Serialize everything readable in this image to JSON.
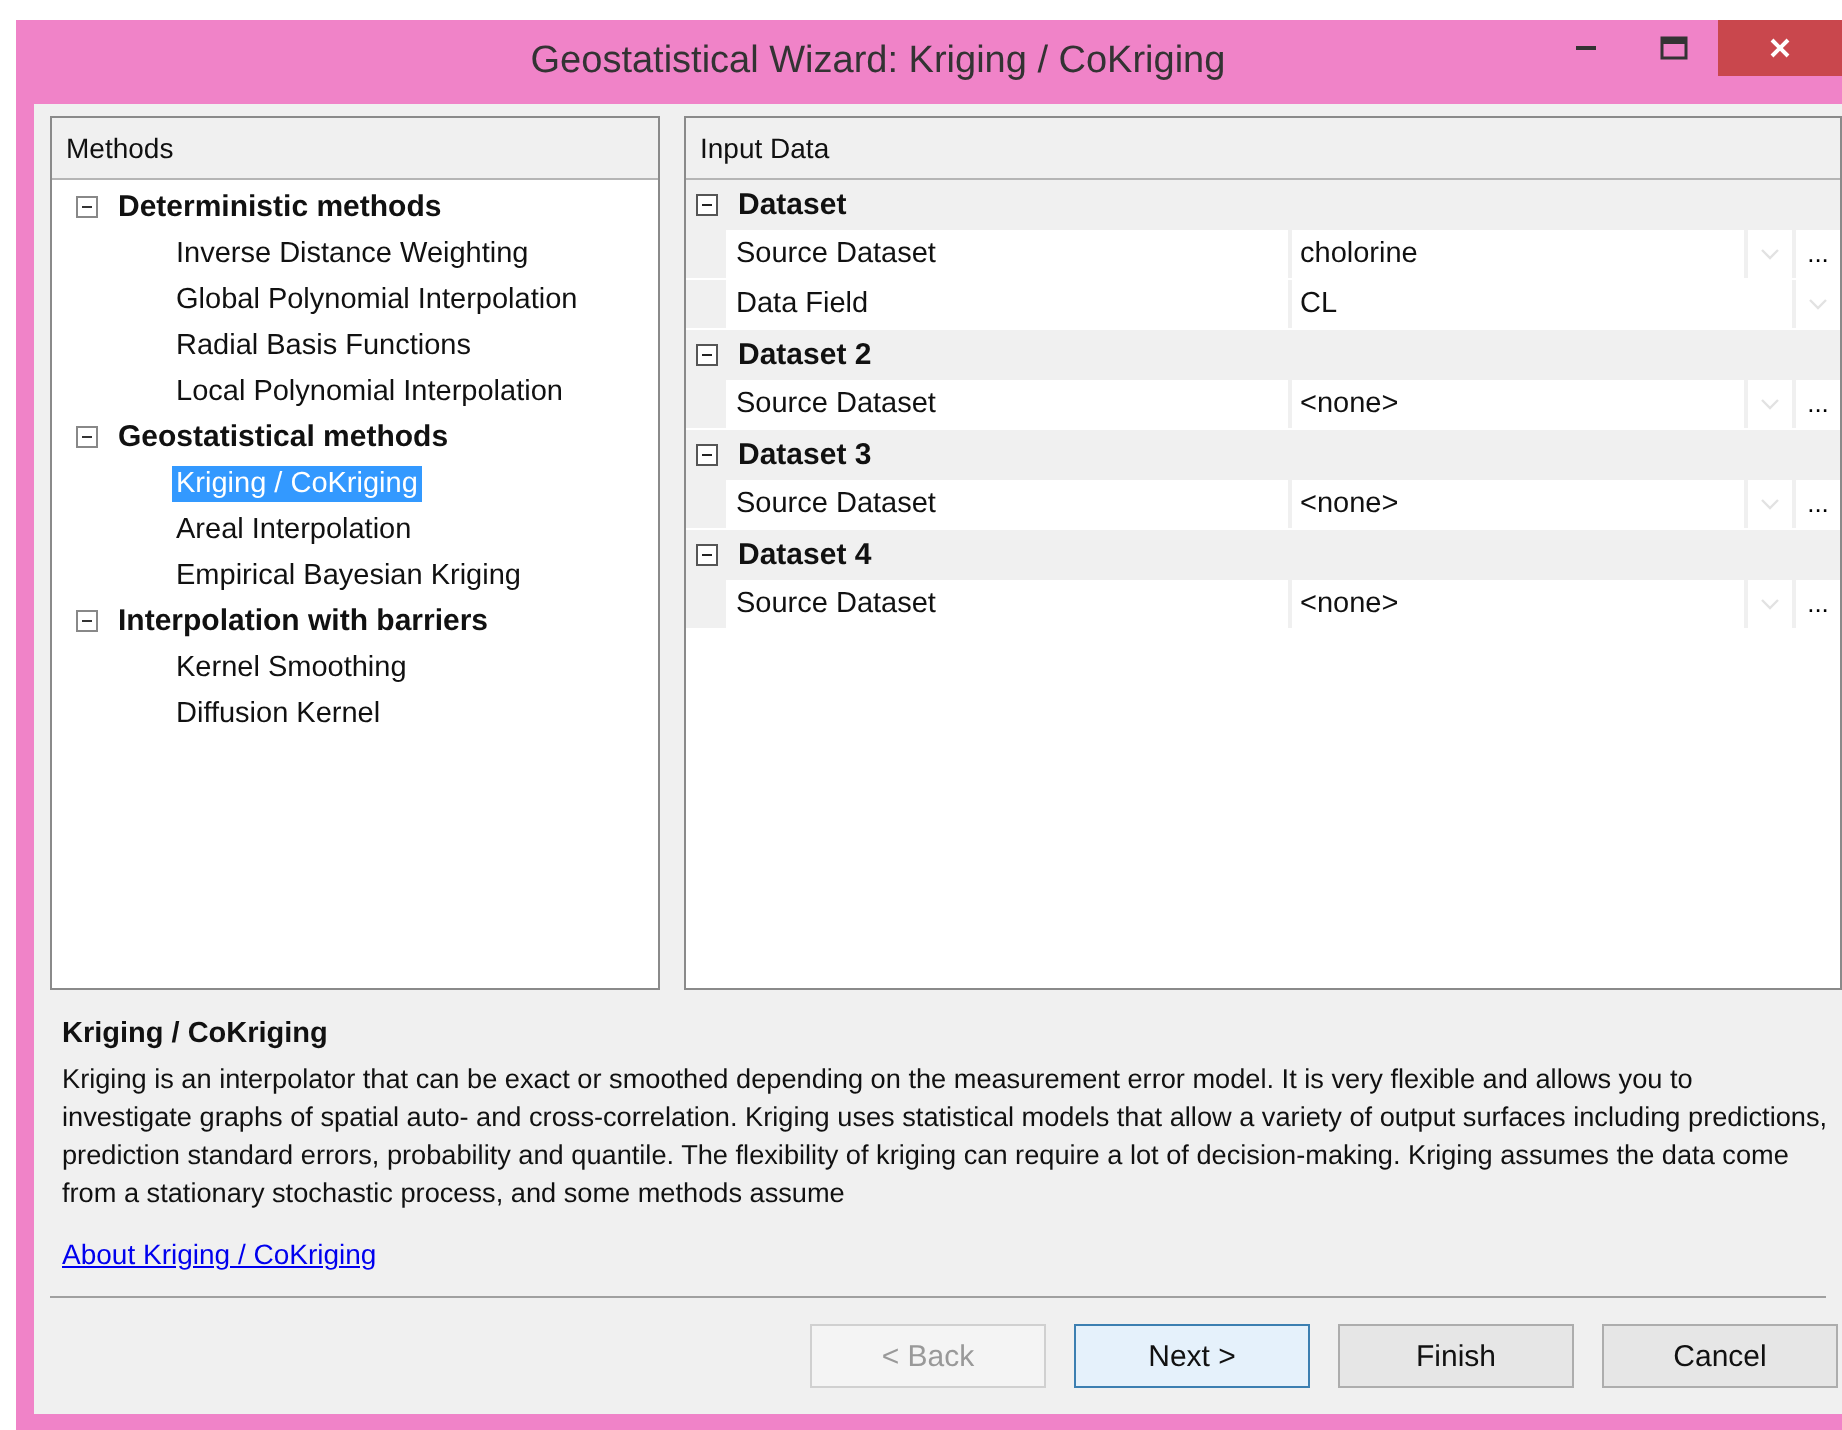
{
  "window": {
    "title": "Geostatistical Wizard: Kriging / CoKriging"
  },
  "methods": {
    "header": "Methods",
    "groups": [
      {
        "label": "Deterministic methods",
        "expanded": true,
        "children": [
          {
            "label": "Inverse Distance Weighting",
            "selected": false
          },
          {
            "label": "Global Polynomial Interpolation",
            "selected": false
          },
          {
            "label": "Radial Basis Functions",
            "selected": false
          },
          {
            "label": "Local Polynomial Interpolation",
            "selected": false
          }
        ]
      },
      {
        "label": "Geostatistical methods",
        "expanded": true,
        "children": [
          {
            "label": "Kriging / CoKriging",
            "selected": true
          },
          {
            "label": "Areal Interpolation",
            "selected": false
          },
          {
            "label": "Empirical Bayesian Kriging",
            "selected": false
          }
        ]
      },
      {
        "label": "Interpolation with barriers",
        "expanded": true,
        "children": [
          {
            "label": "Kernel Smoothing",
            "selected": false
          },
          {
            "label": "Diffusion Kernel",
            "selected": false
          }
        ]
      }
    ]
  },
  "input_data": {
    "header": "Input Data",
    "categories": [
      {
        "label": "Dataset",
        "expanded": true,
        "rows": [
          {
            "kind": "dataset",
            "label": "Source Dataset",
            "value": "cholorine"
          },
          {
            "kind": "field",
            "label": "Data Field",
            "value": "CL"
          }
        ]
      },
      {
        "label": "Dataset 2",
        "expanded": true,
        "rows": [
          {
            "kind": "dataset",
            "label": "Source Dataset",
            "value": "<none>"
          }
        ]
      },
      {
        "label": "Dataset 3",
        "expanded": true,
        "rows": [
          {
            "kind": "dataset",
            "label": "Source Dataset",
            "value": "<none>"
          }
        ]
      },
      {
        "label": "Dataset 4",
        "expanded": true,
        "rows": [
          {
            "kind": "dataset",
            "label": "Source Dataset",
            "value": "<none>"
          }
        ]
      }
    ],
    "ellipsis": "..."
  },
  "description": {
    "title": "Kriging / CoKriging",
    "text": "Kriging is an interpolator that can be exact or smoothed depending on the measurement error model. It is very flexible and allows you to investigate graphs of spatial auto- and cross-correlation. Kriging uses statistical models that allow a variety of output surfaces including predictions, prediction standard errors, probability and quantile. The flexibility of kriging can require a lot of decision-making. Kriging assumes the data come from a stationary stochastic process, and some methods assume",
    "link": "About Kriging / CoKriging"
  },
  "buttons": [
    {
      "label": "< Back",
      "disabled": true,
      "default": false
    },
    {
      "label": "Next >",
      "disabled": false,
      "default": true
    },
    {
      "label": "Finish",
      "disabled": false,
      "default": false
    },
    {
      "label": "Cancel",
      "disabled": false,
      "default": false
    }
  ]
}
